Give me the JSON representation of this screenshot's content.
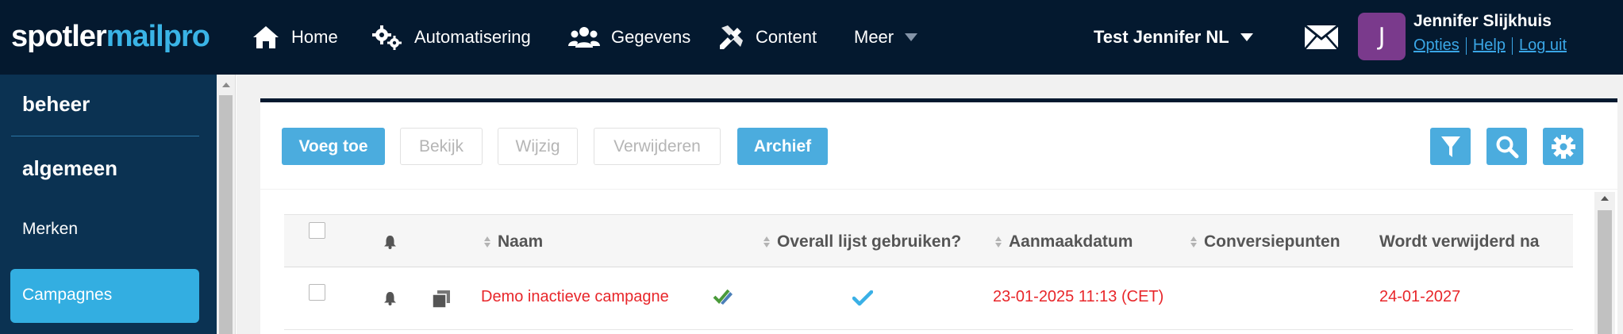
{
  "app": {
    "logo_part1": "spotler",
    "logo_part2": "mailpro",
    "colors": {
      "nav_bg": "#04192f",
      "sidebar_bg": "#0b3252",
      "accent": "#33aee1",
      "button": "#4bacde",
      "link": "#3aa6e6",
      "date_red": "#e8262a",
      "avatar": "#7a3a8c"
    }
  },
  "nav": {
    "items": [
      {
        "label": "Home",
        "icon": "home-icon"
      },
      {
        "label": "Automatisering",
        "icon": "gears-icon"
      },
      {
        "label": "Gegevens",
        "icon": "users-icon"
      },
      {
        "label": "Content",
        "icon": "pencil-ruler-icon"
      },
      {
        "label": "Meer",
        "icon": "chevron-down-icon"
      }
    ],
    "account": "Test Jennifer NL",
    "mail_icon": "envelope-icon"
  },
  "user": {
    "initial": "J",
    "name": "Jennifer Slijkhuis",
    "links": [
      "Opties",
      "Help",
      "Log uit"
    ]
  },
  "sidebar": {
    "section": "beheer",
    "group": "algemeen",
    "items": [
      {
        "label": "Merken",
        "active": false
      },
      {
        "label": "Campagnes",
        "active": true
      }
    ]
  },
  "toolbar": {
    "add": "Voeg toe",
    "view": "Bekijk",
    "edit": "Wijzig",
    "delete": "Verwijderen",
    "archive": "Archief",
    "icons": [
      "filter-icon",
      "search-icon",
      "settings-icon"
    ]
  },
  "table": {
    "columns": [
      "Naam",
      "Overall lijst gebruiken?",
      "Aanmaakdatum",
      "Conversiepunten",
      "Wordt verwijderd na"
    ],
    "rows": [
      {
        "name": "Demo inactieve campagne",
        "overall_list": true,
        "created": "23-01-2025 11:13 (CET)",
        "conversion_points": "",
        "delete_after": "24-01-2027"
      }
    ]
  }
}
